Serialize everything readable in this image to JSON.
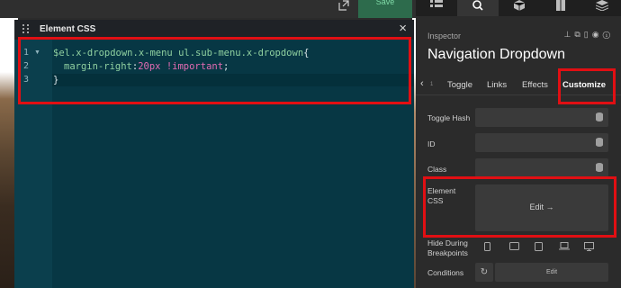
{
  "topbar": {
    "save_label": "Save",
    "icons": [
      "export-icon"
    ]
  },
  "editor": {
    "title": "Element CSS",
    "close_glyph": "×",
    "lines": [
      {
        "number": "1",
        "folded": true
      },
      {
        "number": "2",
        "folded": false
      },
      {
        "number": "3",
        "folded": false
      }
    ],
    "code": {
      "line1_selector": "$el.x-dropdown.x-menu ul.sub-menu.x-dropdown",
      "line1_brace": "{",
      "line2_property": "margin-right",
      "line2_colon": ":",
      "line2_value": "20px",
      "line2_important": "!important",
      "line2_semicolon": ";",
      "line3_brace": "}"
    }
  },
  "inspector": {
    "top_tabs": [
      {
        "icon": "list-icon",
        "active": false
      },
      {
        "icon": "search-icon",
        "active": true
      },
      {
        "icon": "cube-icon",
        "active": false
      },
      {
        "icon": "document-icon",
        "active": false
      },
      {
        "icon": "layers-icon",
        "active": false
      }
    ],
    "label": "Inspector",
    "title": "Navigation Dropdown",
    "subtabs": [
      "Toggle",
      "Links",
      "Effects",
      "Customize"
    ],
    "subtab_index_hint": "1",
    "active_subtab": "Customize",
    "properties": [
      {
        "label": "Toggle Hash",
        "value": ""
      },
      {
        "label": "ID",
        "value": ""
      },
      {
        "label": "Class",
        "value": ""
      }
    ],
    "element_css": {
      "label_line1": "Element",
      "label_line2": "CSS",
      "button_label": "Edit →"
    },
    "hide_during": {
      "label_line1": "Hide During",
      "label_line2": "Breakpoints",
      "breakpoints": [
        "phone-icon",
        "tablet-portrait-icon",
        "tablet-icon",
        "laptop-icon",
        "desktop-icon"
      ]
    },
    "conditions": {
      "label": "Conditions",
      "button_label": "Edit"
    }
  },
  "colors": {
    "highlight": "#e10f13",
    "editor_bg": "#073744",
    "accent_save": "#2d6b4c"
  }
}
